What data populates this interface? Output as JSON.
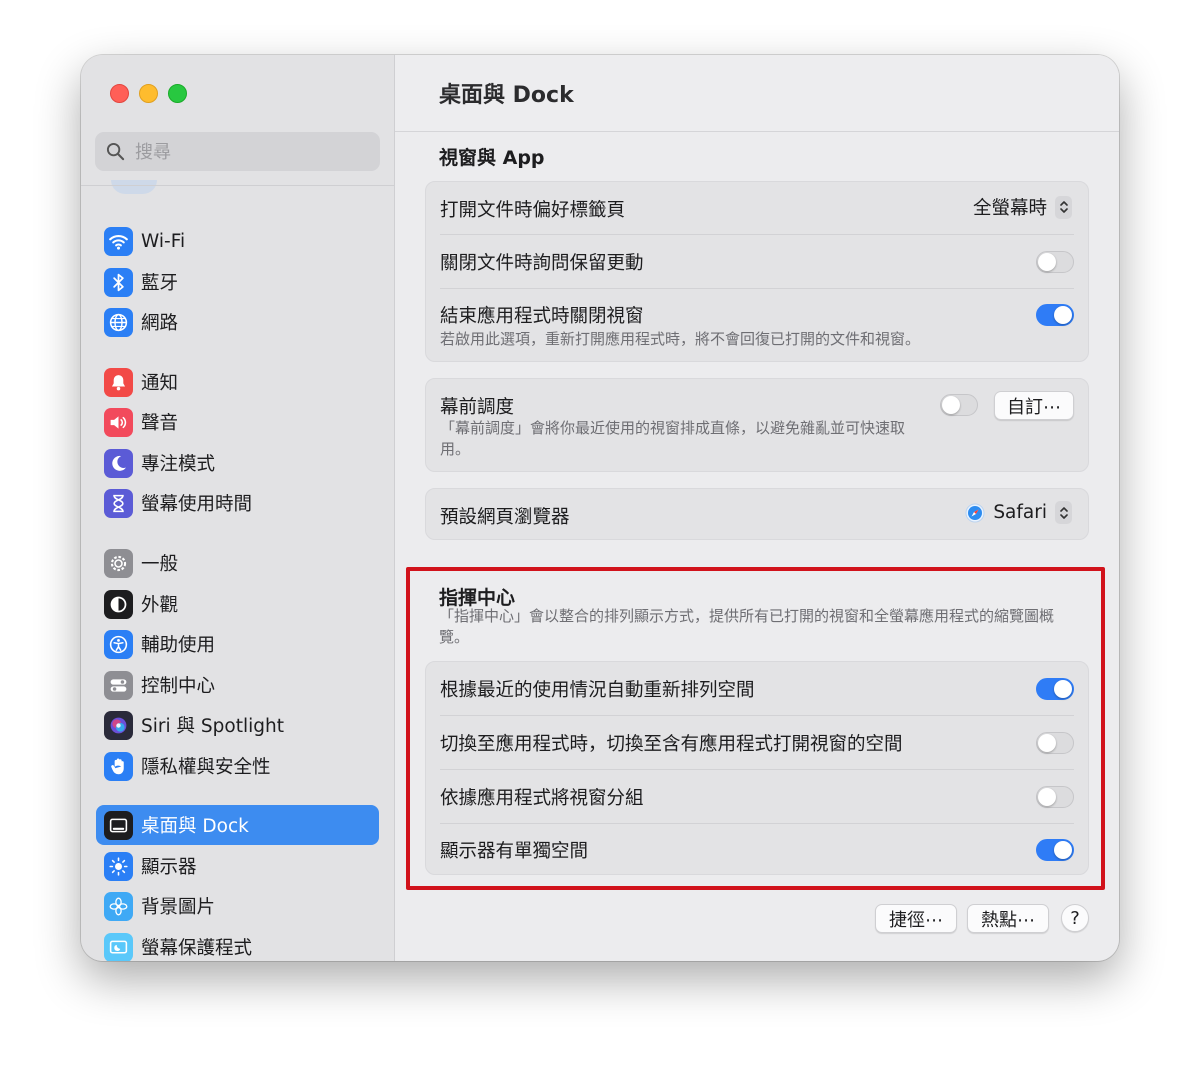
{
  "window": {
    "title": "桌面與 Dock"
  },
  "search": {
    "placeholder": "搜尋"
  },
  "sidebar": {
    "items": [
      {
        "label": "Wi-Fi",
        "icon": "wifi-icon",
        "color": "#2b7ff5"
      },
      {
        "label": "藍牙",
        "icon": "bluetooth-icon",
        "color": "#2b7ff5"
      },
      {
        "label": "網路",
        "icon": "globe-icon",
        "color": "#2b7ff5"
      },
      {
        "label": "通知",
        "icon": "bell-icon",
        "color": "#f24a47"
      },
      {
        "label": "聲音",
        "icon": "speaker-icon",
        "color": "#f24a5c"
      },
      {
        "label": "專注模式",
        "icon": "moon-icon",
        "color": "#5b5bd6"
      },
      {
        "label": "螢幕使用時間",
        "icon": "hourglass-icon",
        "color": "#5b5bd6"
      },
      {
        "label": "一般",
        "icon": "gear-icon",
        "color": "#8e8e93"
      },
      {
        "label": "外觀",
        "icon": "appearance-icon",
        "color": "#1d1d1f"
      },
      {
        "label": "輔助使用",
        "icon": "accessibility-icon",
        "color": "#2b7ff5"
      },
      {
        "label": "控制中心",
        "icon": "control-center-icon",
        "color": "#8e8e93"
      },
      {
        "label": "Siri 與 Spotlight",
        "icon": "siri-icon",
        "color": "#2a2a3a"
      },
      {
        "label": "隱私權與安全性",
        "icon": "hand-icon",
        "color": "#2b7ff5"
      },
      {
        "label": "桌面與 Dock",
        "icon": "dock-icon",
        "color": "#1d1d1f"
      },
      {
        "label": "顯示器",
        "icon": "sun-icon",
        "color": "#2b7ff5"
      },
      {
        "label": "背景圖片",
        "icon": "flower-icon",
        "color": "#3fa9f5"
      },
      {
        "label": "螢幕保護程式",
        "icon": "screensaver-icon",
        "color": "#5ac8fa"
      }
    ]
  },
  "windows_apps": {
    "title": "視窗與 App",
    "prefer_tabs_label": "打開文件時偏好標籤頁",
    "prefer_tabs_value": "全螢幕時",
    "ask_keep_changes_label": "關閉文件時詢問保留更動",
    "close_windows_label": "結束應用程式時關閉視窗",
    "close_windows_sub": "若啟用此選項，重新打開應用程式時，將不會回復已打開的文件和視窗。",
    "stage_manager_label": "幕前調度",
    "stage_manager_sub": "「幕前調度」會將你最近使用的視窗排成直條，以避免雜亂並可快速取用。",
    "customize_label": "自訂⋯",
    "default_browser_label": "預設網頁瀏覽器",
    "default_browser_value": "Safari"
  },
  "mission_control": {
    "title": "指揮中心",
    "sub": "「指揮中心」會以整合的排列顯示方式，提供所有已打開的視窗和全螢幕應用程式的縮覽圖概覽。",
    "rows": [
      {
        "label": "根據最近的使用情況自動重新排列空間",
        "on": true
      },
      {
        "label": "切換至應用程式時，切換至含有應用程式打開視窗的空間",
        "on": false
      },
      {
        "label": "依據應用程式將視窗分組",
        "on": false
      },
      {
        "label": "顯示器有單獨空間",
        "on": true
      }
    ]
  },
  "footer": {
    "shortcuts_label": "捷徑⋯",
    "hot_corners_label": "熱點⋯",
    "help_label": "?"
  },
  "colors": {
    "accent": "#2f7cf6",
    "selection": "#3d8cf0",
    "highlight_box": "#d1121b"
  }
}
